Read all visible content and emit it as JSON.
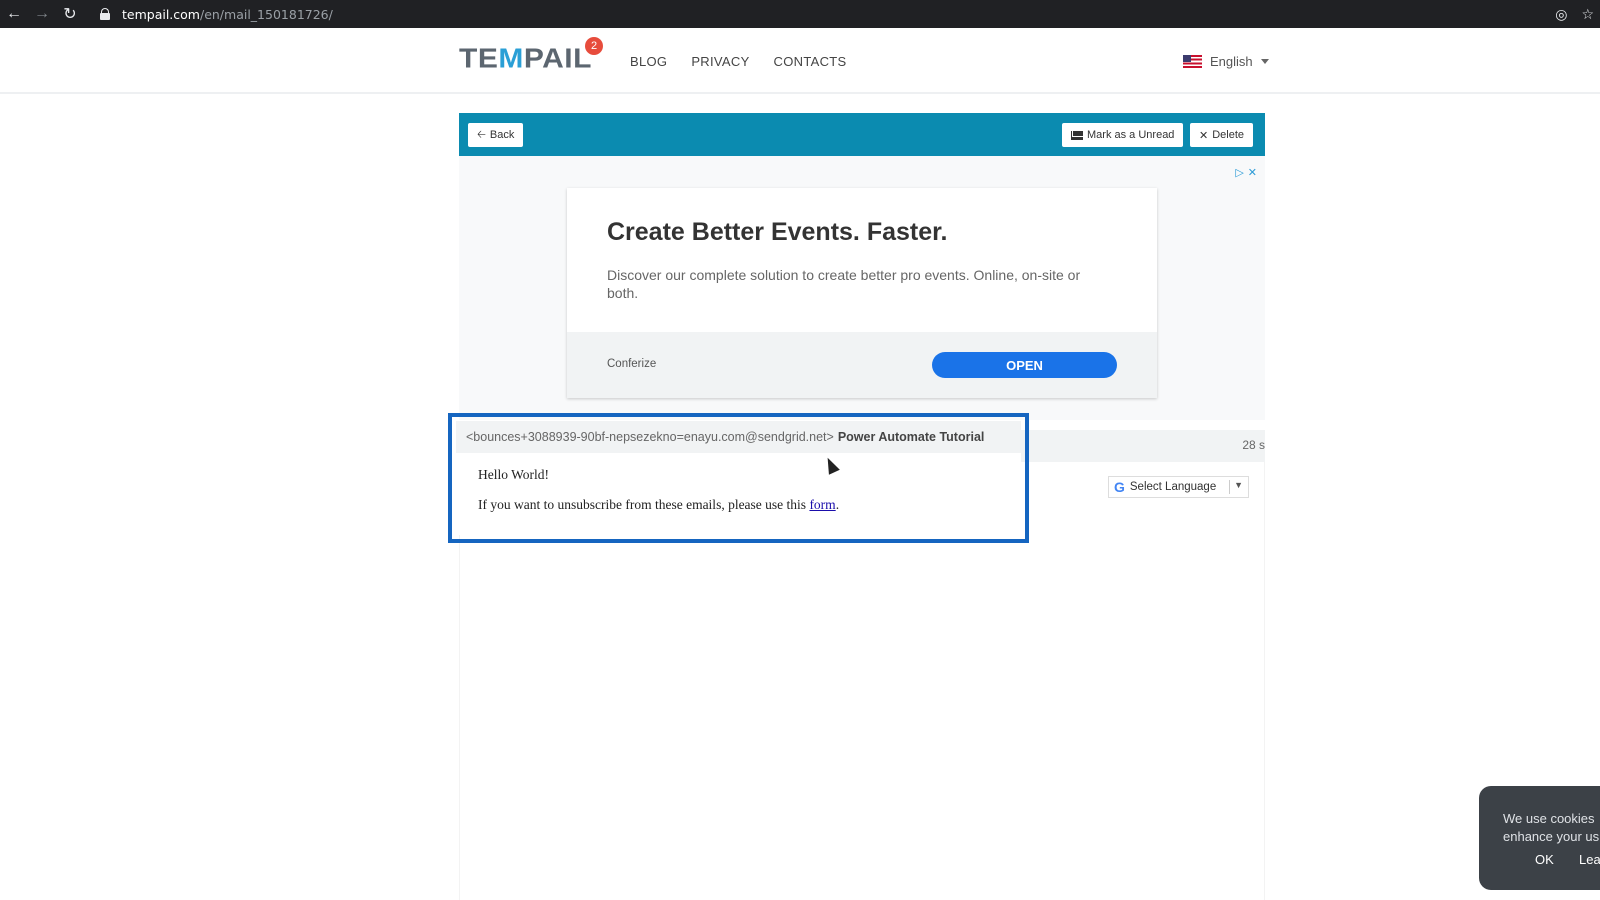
{
  "browser": {
    "url_host": "tempail.com",
    "url_path": "/en/mail_150181726/"
  },
  "header": {
    "logo_pre": "TE",
    "logo_m": "M",
    "logo_post": "PAIL",
    "badge_count": "2",
    "nav": [
      "BLOG",
      "PRIVACY",
      "CONTACTS"
    ],
    "language": "English"
  },
  "toolbar": {
    "back_label": "Back",
    "mark_unread_label": "Mark as a Unread",
    "delete_label": "Delete"
  },
  "ad": {
    "title": "Create Better Events. Faster.",
    "description": "Discover our complete solution to create better pro events. Online, on-site or both.",
    "brand": "Conferize",
    "cta": "OPEN"
  },
  "mail": {
    "from": "<bounces+3088939-90bf-nepsezekno=enayu.com@sendgrid.net>",
    "subject": "Power Automate Tutorial",
    "time": "28 s",
    "body_line1": "Hello World!",
    "body_line2_prefix": "If you want to unsubscribe from these emails, please use this ",
    "body_link": "form",
    "body_line2_suffix": "."
  },
  "translate": {
    "label": "Select Language"
  },
  "cookie": {
    "text": "We use cookies enhance your us",
    "ok": "OK",
    "learn": "Lea"
  },
  "colors": {
    "toolbar": "#0b8bb0",
    "highlight": "#1565c0",
    "cta": "#1a73e8"
  }
}
